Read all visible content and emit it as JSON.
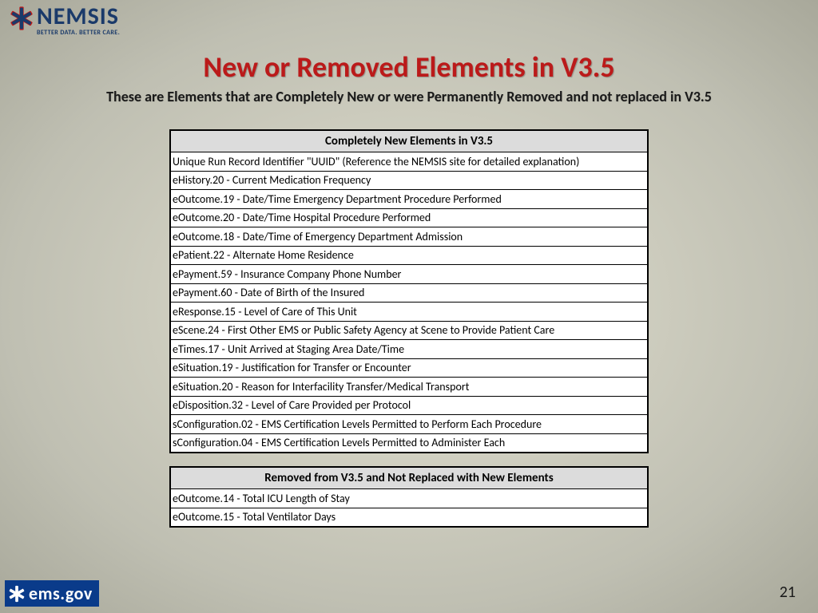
{
  "logo": {
    "brand": "NEMSIS",
    "tagline": "BETTER DATA. BETTER CARE."
  },
  "title": "New or Removed Elements in V3.5",
  "subtitle": "These are Elements that are Completely New or were Permanently Removed and not replaced in V3.5",
  "table1": {
    "header": "Completely New Elements in V3.5",
    "rows": [
      "Unique Run Record Identifier \"UUID\" (Reference the NEMSIS site for detailed explanation)",
      "eHistory.20 - Current Medication Frequency",
      "eOutcome.19 - Date/Time Emergency Department Procedure Performed",
      "eOutcome.20 - Date/Time Hospital Procedure Performed",
      "eOutcome.18 - Date/Time of Emergency Department Admission",
      "ePatient.22 - Alternate Home Residence",
      "ePayment.59 - Insurance Company Phone Number",
      "ePayment.60 - Date of Birth of the Insured",
      "eResponse.15 - Level of Care of This Unit",
      "eScene.24 - First Other EMS or Public Safety Agency at Scene to Provide Patient Care",
      "eTimes.17 - Unit Arrived at Staging Area Date/Time",
      "eSituation.19 - Justification for Transfer or Encounter",
      "eSituation.20 - Reason for Interfacility Transfer/Medical Transport",
      "eDisposition.32 - Level of Care Provided per Protocol",
      "sConfiguration.02 - EMS Certification Levels Permitted to Perform Each Procedure",
      "sConfiguration.04 - EMS Certification Levels Permitted to Administer Each"
    ]
  },
  "table2": {
    "header": "Removed from V3.5 and Not Replaced with New Elements",
    "rows": [
      "eOutcome.14 - Total ICU Length of Stay",
      "eOutcome.15 - Total Ventilator Days"
    ]
  },
  "footer": {
    "ems_label": "ems.gov",
    "page": "21"
  }
}
